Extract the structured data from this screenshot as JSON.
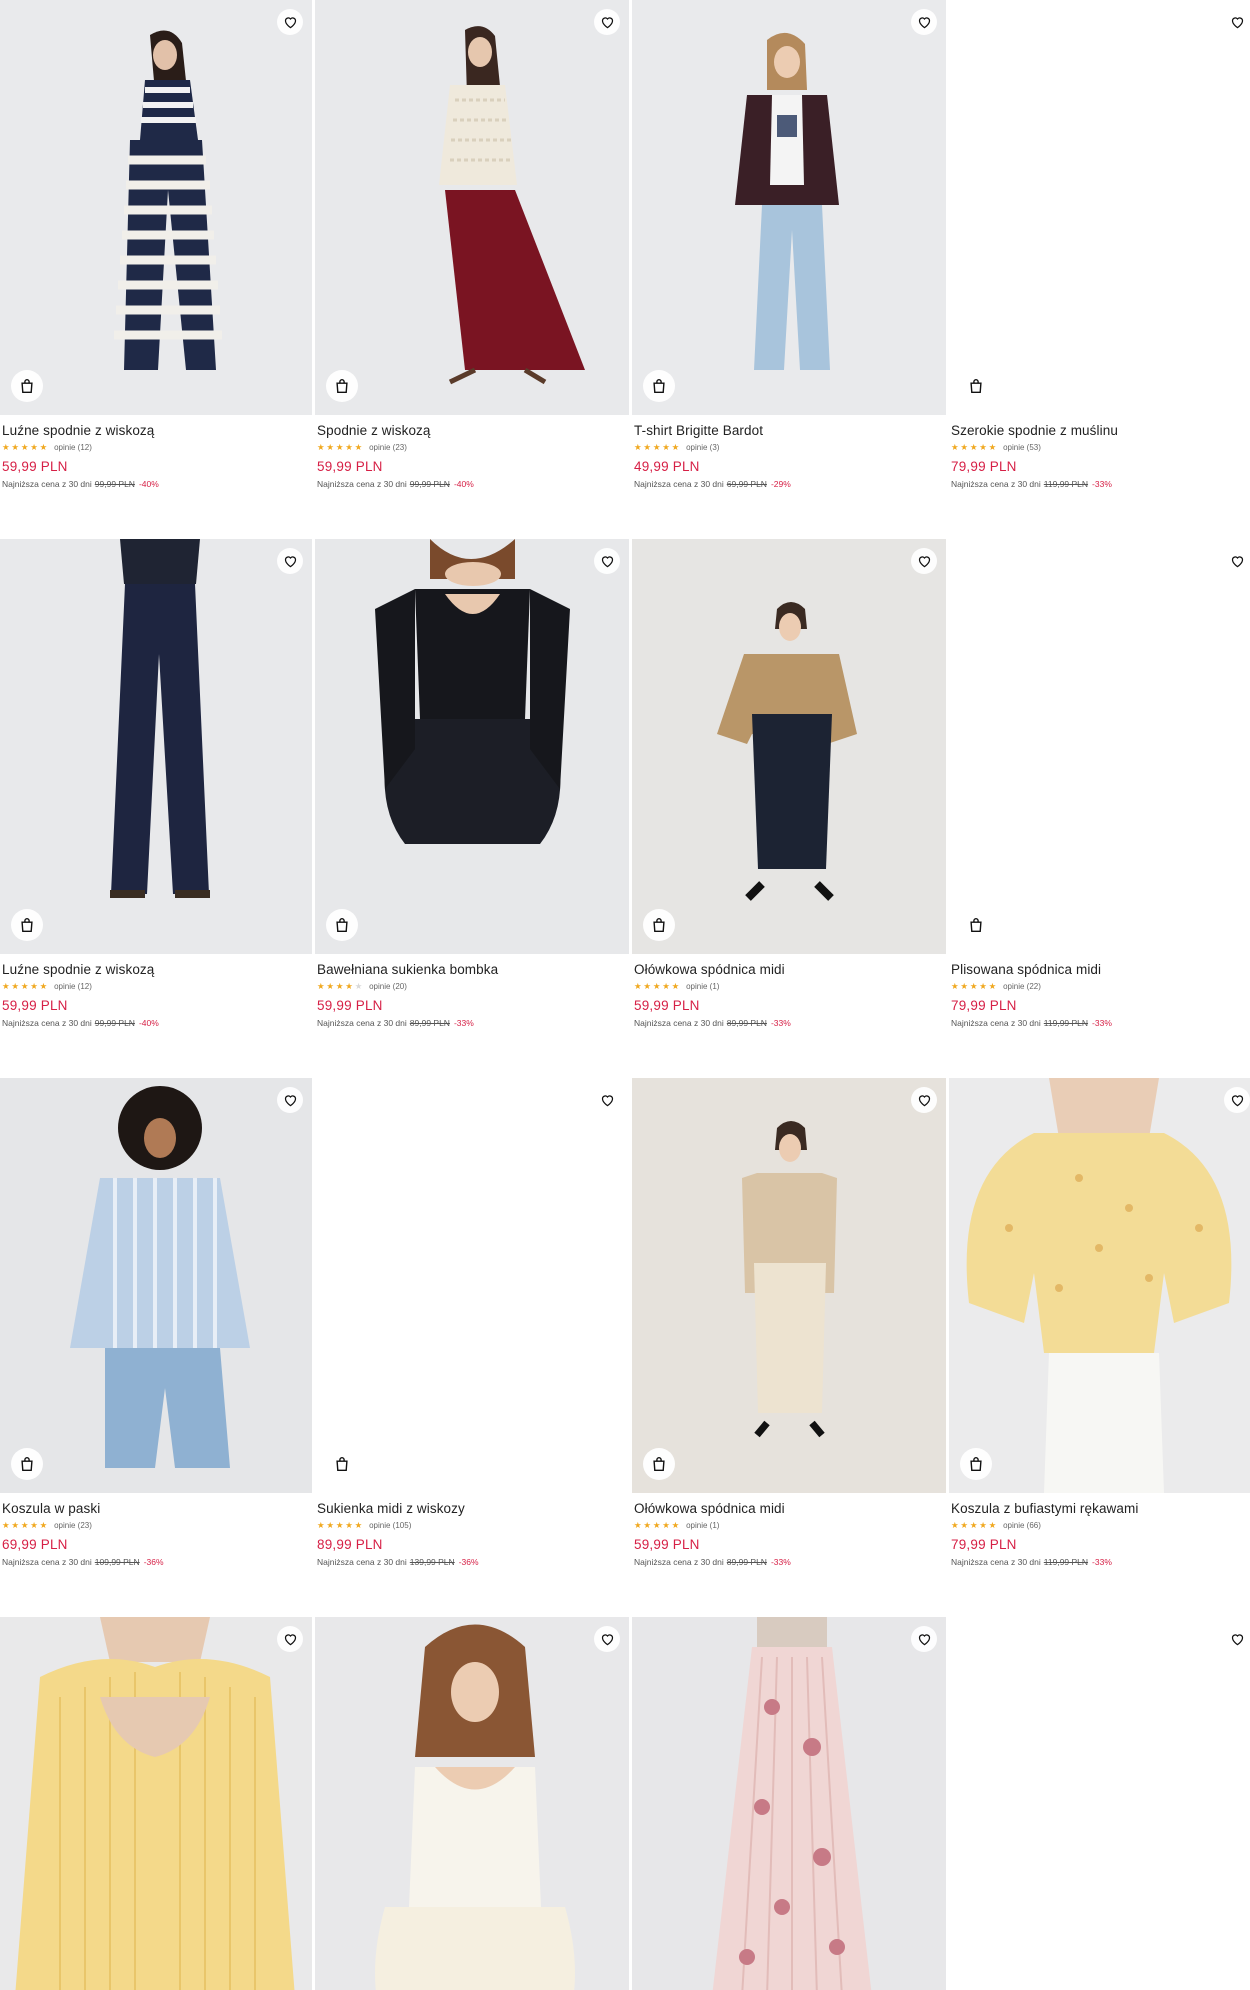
{
  "icons": {
    "favorite": "heart-outline-icon",
    "cart": "shopping-bag-icon"
  },
  "colors": {
    "price": "#d61f45",
    "stars": "#f0a81f",
    "photo_bg": "#eceef1"
  },
  "products": [
    {
      "name": "Luźne spodnie z wiskozą",
      "stars": "★★★★★",
      "reviews": "opinie (12)",
      "price": "59,99 PLN",
      "lowest_label": "Najniższa cena z 30 dni",
      "old_price": "99,99 PLN",
      "discount": "-40%",
      "rating": 4.5,
      "has_photo": true
    },
    {
      "name": "Spodnie z wiskozą",
      "stars": "★★★★★",
      "reviews": "opinie (23)",
      "price": "59,99 PLN",
      "lowest_label": "Najniższa cena z 30 dni",
      "old_price": "99,99 PLN",
      "discount": "-40%",
      "rating": 5,
      "has_photo": true
    },
    {
      "name": "T-shirt Brigitte Bardot",
      "stars": "★★★★★",
      "reviews": "opinie (3)",
      "price": "49,99 PLN",
      "lowest_label": "Najniższa cena z 30 dni",
      "old_price": "69,99 PLN",
      "discount": "-29%",
      "rating": 5,
      "has_photo": true
    },
    {
      "name": "Szerokie spodnie z muślinu",
      "stars": "★★★★★",
      "reviews": "opinie (53)",
      "price": "79,99 PLN",
      "lowest_label": "Najniższa cena z 30 dni",
      "old_price": "119,99 PLN",
      "discount": "-33%",
      "rating": 4.5,
      "has_photo": false
    },
    {
      "name": "Luźne spodnie z wiskozą",
      "stars": "★★★★★",
      "reviews": "opinie (12)",
      "price": "59,99 PLN",
      "lowest_label": "Najniższa cena z 30 dni",
      "old_price": "99,99 PLN",
      "discount": "-40%",
      "rating": 4.5,
      "has_photo": true
    },
    {
      "name": "Bawełniana sukienka bombka",
      "stars": "★★★★★",
      "reviews": "opinie (20)",
      "price": "59,99 PLN",
      "lowest_label": "Najniższa cena z 30 dni",
      "old_price": "89,99 PLN",
      "discount": "-33%",
      "rating": 4,
      "has_photo": true
    },
    {
      "name": "Ołówkowa spódnica midi",
      "stars": "★★★★★",
      "reviews": "opinie (1)",
      "price": "59,99 PLN",
      "lowest_label": "Najniższa cena z 30 dni",
      "old_price": "89,99 PLN",
      "discount": "-33%",
      "rating": 5,
      "has_photo": true
    },
    {
      "name": "Plisowana spódnica midi",
      "stars": "★★★★★",
      "reviews": "opinie (22)",
      "price": "79,99 PLN",
      "lowest_label": "Najniższa cena z 30 dni",
      "old_price": "119,99 PLN",
      "discount": "-33%",
      "rating": 5,
      "has_photo": false
    },
    {
      "name": "Koszula w paski",
      "stars": "★★★★★",
      "reviews": "opinie (23)",
      "price": "69,99 PLN",
      "lowest_label": "Najniższa cena z 30 dni",
      "old_price": "109,99 PLN",
      "discount": "-36%",
      "rating": 4.5,
      "has_photo": true
    },
    {
      "name": "Sukienka midi z wiskozy",
      "stars": "★★★★★",
      "reviews": "opinie (105)",
      "price": "89,99 PLN",
      "lowest_label": "Najniższa cena z 30 dni",
      "old_price": "139,99 PLN",
      "discount": "-36%",
      "rating": 4.5,
      "has_photo": false
    },
    {
      "name": "Ołówkowa spódnica midi",
      "stars": "★★★★★",
      "reviews": "opinie (1)",
      "price": "59,99 PLN",
      "lowest_label": "Najniższa cena z 30 dni",
      "old_price": "89,99 PLN",
      "discount": "-33%",
      "rating": 5,
      "has_photo": true
    },
    {
      "name": "Koszula z bufiastymi rękawami",
      "stars": "★★★★★",
      "reviews": "opinie (66)",
      "price": "79,99 PLN",
      "lowest_label": "Najniższa cena z 30 dni",
      "old_price": "119,99 PLN",
      "discount": "-33%",
      "rating": 5,
      "has_photo": true
    },
    {
      "has_photo": true
    },
    {
      "has_photo": true
    },
    {
      "has_photo": true
    },
    {
      "has_photo": false
    }
  ]
}
